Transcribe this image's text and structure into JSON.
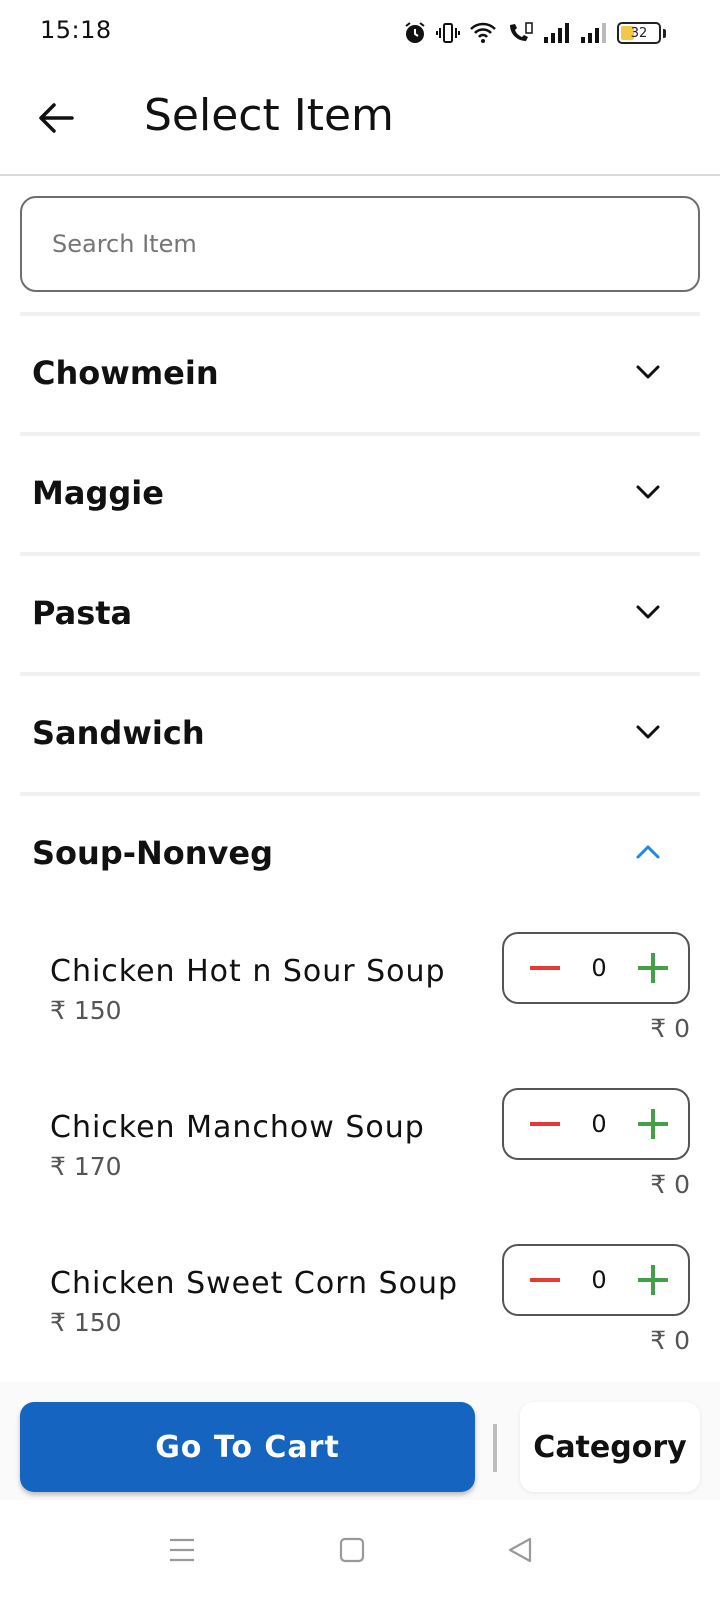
{
  "status_bar": {
    "time": "15:18",
    "battery_level": "32",
    "icons": [
      "alarm-icon",
      "vibrate-icon",
      "wifi-icon",
      "wifi-calling-icon",
      "signal-icon",
      "signal-icon",
      "battery-icon"
    ]
  },
  "app_bar": {
    "title": "Select Item",
    "back_icon": "arrow-left-icon"
  },
  "search": {
    "placeholder": "Search Item",
    "value": ""
  },
  "categories": [
    {
      "name": "Chowmein",
      "expanded": false
    },
    {
      "name": "Maggie",
      "expanded": false
    },
    {
      "name": "Pasta",
      "expanded": false
    },
    {
      "name": "Sandwich",
      "expanded": false
    },
    {
      "name": "Soup-Nonveg",
      "expanded": true
    }
  ],
  "items": [
    {
      "name": "Chicken Hot n Sour Soup",
      "price": "₹ 150",
      "qty": "0",
      "total": "₹ 0"
    },
    {
      "name": "Chicken Manchow Soup",
      "price": "₹ 170",
      "qty": "0",
      "total": "₹ 0"
    },
    {
      "name": "Chicken Sweet Corn Soup",
      "price": "₹ 150",
      "qty": "0",
      "total": "₹ 0"
    }
  ],
  "bottom_bar": {
    "cart_label": "Go To Cart",
    "category_label": "Category"
  },
  "colors": {
    "primary": "#1565c0",
    "minus": "#e53935",
    "plus": "#43a047",
    "expanded_chevron": "#1e88e5"
  },
  "nav_bar": {
    "icons": [
      "menu-icon",
      "home-square-icon",
      "back-triangle-icon"
    ]
  }
}
